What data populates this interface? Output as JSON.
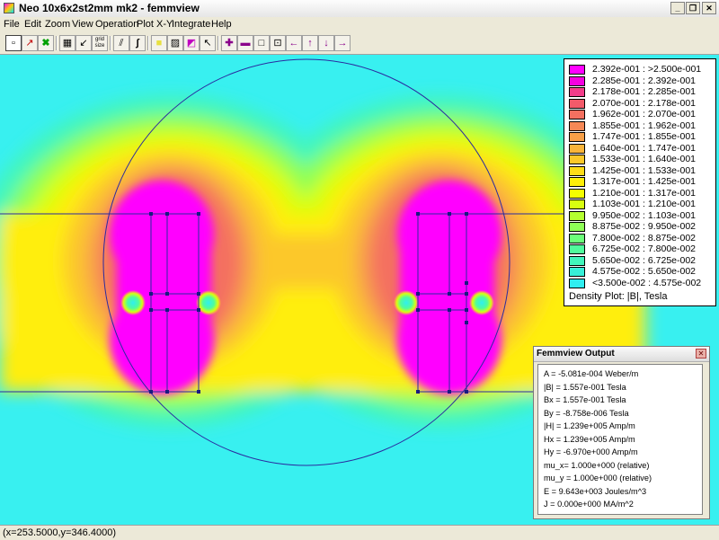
{
  "window": {
    "title": "Neo 10x6x2st2mm mk2 - femmview",
    "controls": [
      "_",
      "❐",
      "✕"
    ]
  },
  "menu": [
    "File",
    "Edit",
    "Zoom",
    "View",
    "Operation",
    "Plot X-Y",
    "Integrate",
    "Help"
  ],
  "toolbar": {
    "buttons": [
      {
        "name": "select-point-button",
        "glyph": "▫"
      },
      {
        "name": "draw-line-button",
        "glyph": "↗"
      },
      {
        "name": "select-region-button",
        "glyph": "✖"
      },
      {
        "name": "show-mesh-button",
        "glyph": "▦"
      },
      {
        "name": "vector-plot-button",
        "glyph": "↙"
      },
      {
        "name": "grid-size-button",
        "glyph": "grid size"
      },
      {
        "name": "plot-xy-button",
        "glyph": "⫽"
      },
      {
        "name": "integrate-button",
        "glyph": "∫"
      },
      {
        "name": "contour-yellow-button",
        "glyph": "■"
      },
      {
        "name": "hatch-button",
        "glyph": "▨"
      },
      {
        "name": "density-plot-button",
        "glyph": "◩"
      },
      {
        "name": "pointer-button",
        "glyph": "↖"
      },
      {
        "name": "zoom-in-button",
        "glyph": "✚"
      },
      {
        "name": "zoom-out-button",
        "glyph": "▬"
      },
      {
        "name": "zoom-natural-button",
        "glyph": "□"
      },
      {
        "name": "zoom-window-button",
        "glyph": "⊡"
      },
      {
        "name": "pan-left-button",
        "glyph": "←"
      },
      {
        "name": "pan-up-button",
        "glyph": "↑"
      },
      {
        "name": "pan-down-button",
        "glyph": "↓"
      },
      {
        "name": "pan-right-button",
        "glyph": "→"
      }
    ]
  },
  "legend": {
    "caption": "Density Plot: |B|, Tesla",
    "entries": [
      {
        "label": "2.392e-001 : >2.500e-001",
        "color": "#ff00ff"
      },
      {
        "label": "2.285e-001 : 2.392e-001",
        "color": "#f400e0"
      },
      {
        "label": "2.178e-001 : 2.285e-001",
        "color": "#f23c8a"
      },
      {
        "label": "2.070e-001 : 2.178e-001",
        "color": "#f25a6a"
      },
      {
        "label": "1.962e-001 : 2.070e-001",
        "color": "#f47060"
      },
      {
        "label": "1.855e-001 : 1.962e-001",
        "color": "#f68856"
      },
      {
        "label": "1.747e-001 : 1.855e-001",
        "color": "#f8a048"
      },
      {
        "label": "1.640e-001 : 1.747e-001",
        "color": "#fab43a"
      },
      {
        "label": "1.533e-001 : 1.640e-001",
        "color": "#fcc82a"
      },
      {
        "label": "1.425e-001 : 1.533e-001",
        "color": "#fedc18"
      },
      {
        "label": "1.317e-001 : 1.425e-001",
        "color": "#ffee08"
      },
      {
        "label": "1.210e-001 : 1.317e-001",
        "color": "#f4ff00"
      },
      {
        "label": "1.103e-001 : 1.210e-001",
        "color": "#d8ff10"
      },
      {
        "label": "9.950e-002 : 1.103e-001",
        "color": "#b4ff30"
      },
      {
        "label": "8.875e-002 : 9.950e-002",
        "color": "#8eff56"
      },
      {
        "label": "7.800e-002 : 8.875e-002",
        "color": "#6cff7a"
      },
      {
        "label": "6.725e-002 : 7.800e-002",
        "color": "#50fc9c"
      },
      {
        "label": "5.650e-002 : 6.725e-002",
        "color": "#42f6bc"
      },
      {
        "label": "4.575e-002 : 5.650e-002",
        "color": "#38f0d8"
      },
      {
        "label": "<3.500e-002 : 4.575e-002",
        "color": "#30eef0"
      }
    ]
  },
  "output": {
    "title": "Femmview Output",
    "close_glyph": "✕",
    "lines": [
      "A  = -5.081e-004 Weber/m",
      "|B| = 1.557e-001 Tesla",
      "Bx  = 1.557e-001 Tesla",
      "By  = -8.758e-006 Tesla",
      "|H| = 1.239e+005 Amp/m",
      "Hx  = 1.239e+005 Amp/m",
      "Hy  = -6.970e+000 Amp/m",
      "mu_x= 1.000e+000 (relative)",
      "mu_y = 1.000e+000 (relative)",
      "E   = 9.643e+003 Joules/m^3",
      "J   = 0.000e+000 MA/m^2"
    ]
  },
  "status": "(x=253.5000,y=346.4000)"
}
